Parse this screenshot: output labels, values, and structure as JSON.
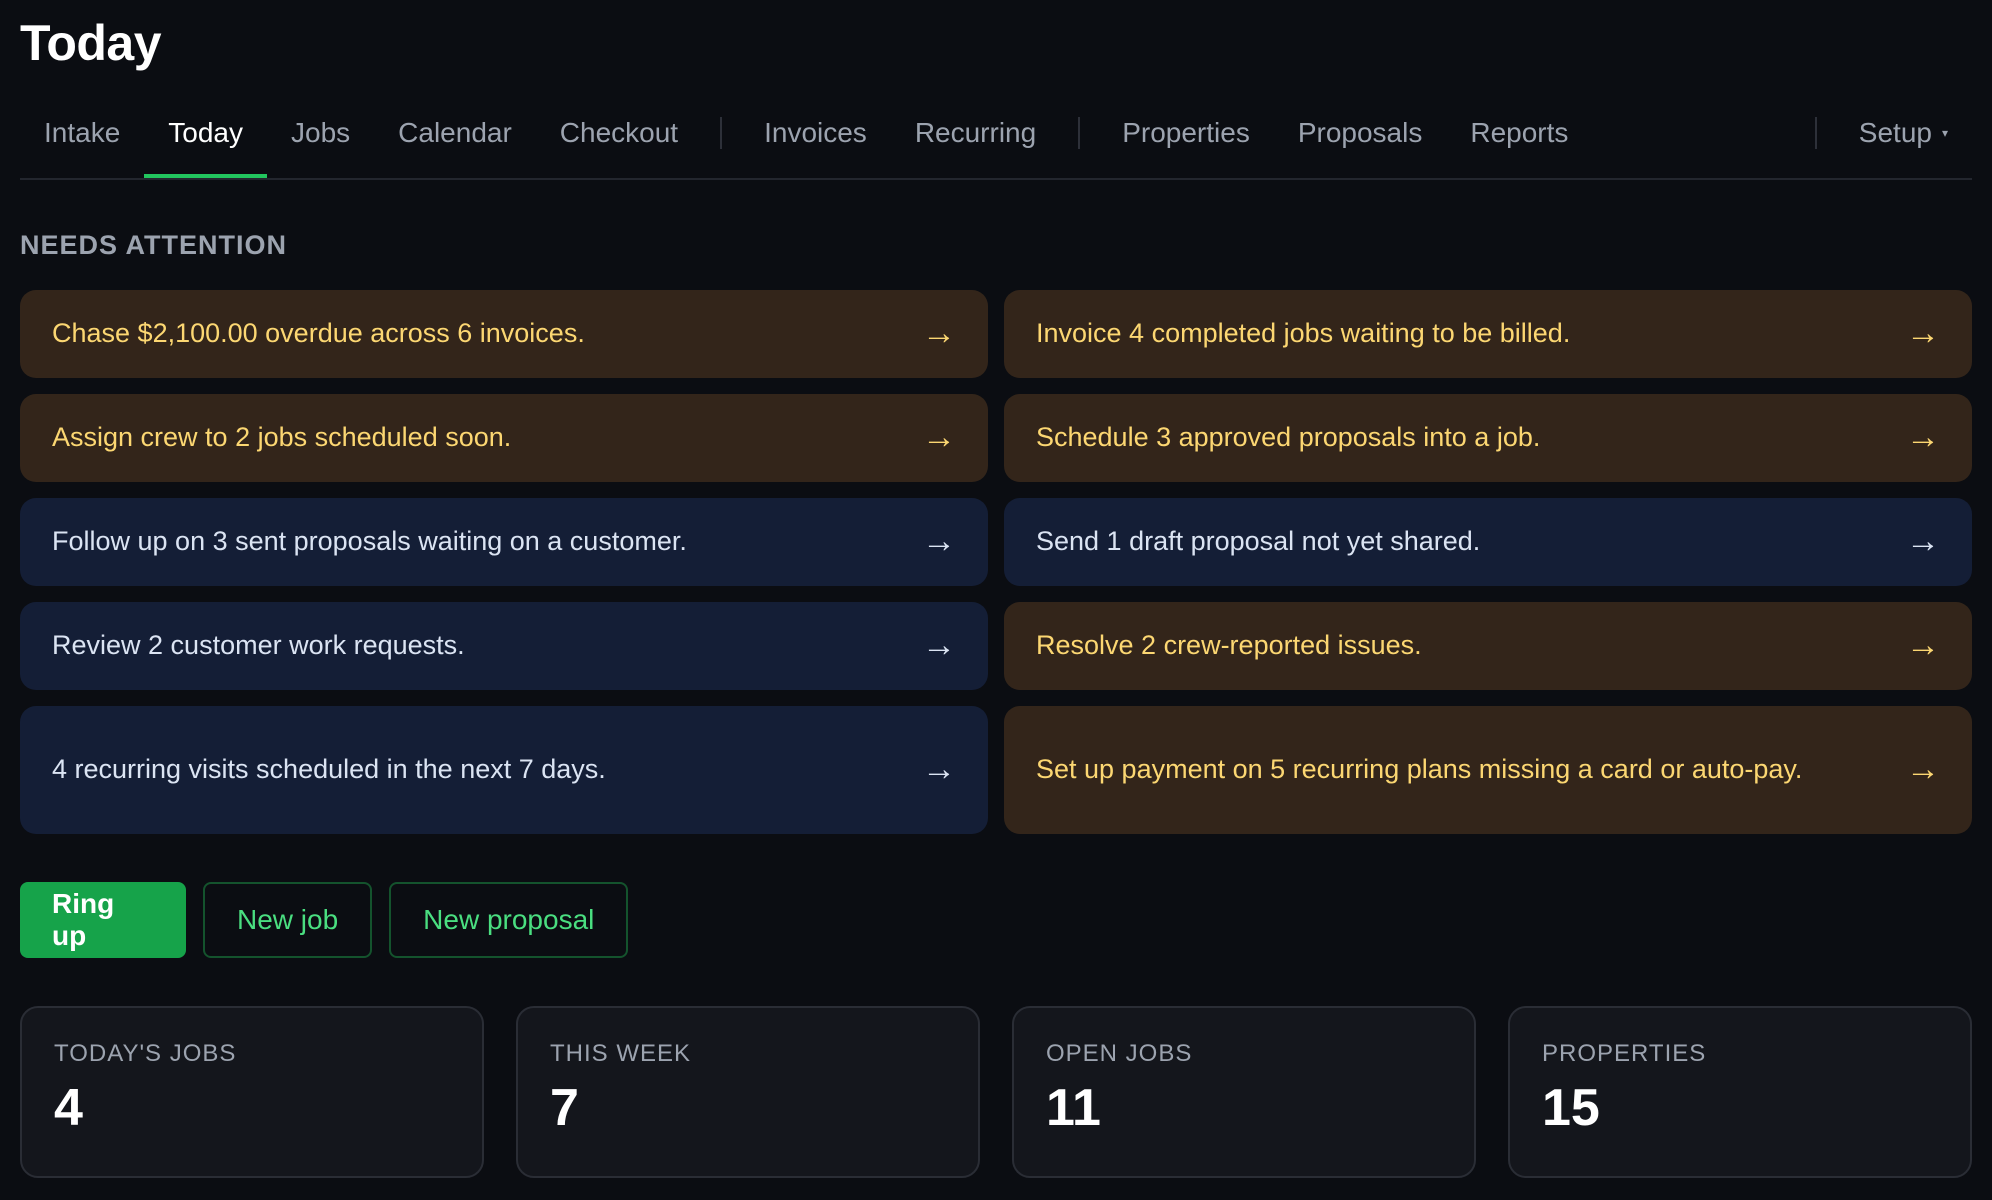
{
  "page": {
    "title": "Today"
  },
  "tabs": {
    "items": [
      {
        "label": "Intake",
        "active": false
      },
      {
        "label": "Today",
        "active": true
      },
      {
        "label": "Jobs",
        "active": false
      },
      {
        "label": "Calendar",
        "active": false
      },
      {
        "label": "Checkout",
        "active": false
      },
      {
        "label": "Invoices",
        "active": false
      },
      {
        "label": "Recurring",
        "active": false
      },
      {
        "label": "Properties",
        "active": false
      },
      {
        "label": "Proposals",
        "active": false
      },
      {
        "label": "Reports",
        "active": false
      }
    ],
    "setup_label": "Setup",
    "setup_caret": "▾"
  },
  "attention": {
    "label": "NEEDS ATTENTION",
    "arrow": "→",
    "cards": [
      {
        "text": "Chase $2,100.00 overdue across 6 invoices.",
        "tone": "warn"
      },
      {
        "text": "Invoice 4 completed jobs waiting to be billed.",
        "tone": "warn"
      },
      {
        "text": "Assign crew to 2 jobs scheduled soon.",
        "tone": "warn"
      },
      {
        "text": "Schedule 3 approved proposals into a job.",
        "tone": "warn"
      },
      {
        "text": "Follow up on 3 sent proposals waiting on a customer.",
        "tone": "info"
      },
      {
        "text": "Send 1 draft proposal not yet shared.",
        "tone": "info"
      },
      {
        "text": "Review 2 customer work requests.",
        "tone": "info"
      },
      {
        "text": "Resolve 2 crew-reported issues.",
        "tone": "warn"
      },
      {
        "text": "4 recurring visits scheduled in the next 7 days.",
        "tone": "info"
      },
      {
        "text": "Set up payment on 5 recurring plans missing a card or auto-pay.",
        "tone": "warn"
      }
    ]
  },
  "actions": {
    "ring_up": "Ring up",
    "new_job": "New job",
    "new_proposal": "New proposal"
  },
  "stats": [
    {
      "label": "TODAY'S JOBS",
      "value": "4"
    },
    {
      "label": "THIS WEEK",
      "value": "7"
    },
    {
      "label": "OPEN JOBS",
      "value": "11"
    },
    {
      "label": "PROPERTIES",
      "value": "15"
    }
  ],
  "colors": {
    "accent": "#22c55e",
    "warn_bg": "#33251a",
    "warn_text": "#fcd772",
    "info_bg": "#141e36",
    "info_text": "#dbe4f3",
    "background": "#0b0d12"
  }
}
